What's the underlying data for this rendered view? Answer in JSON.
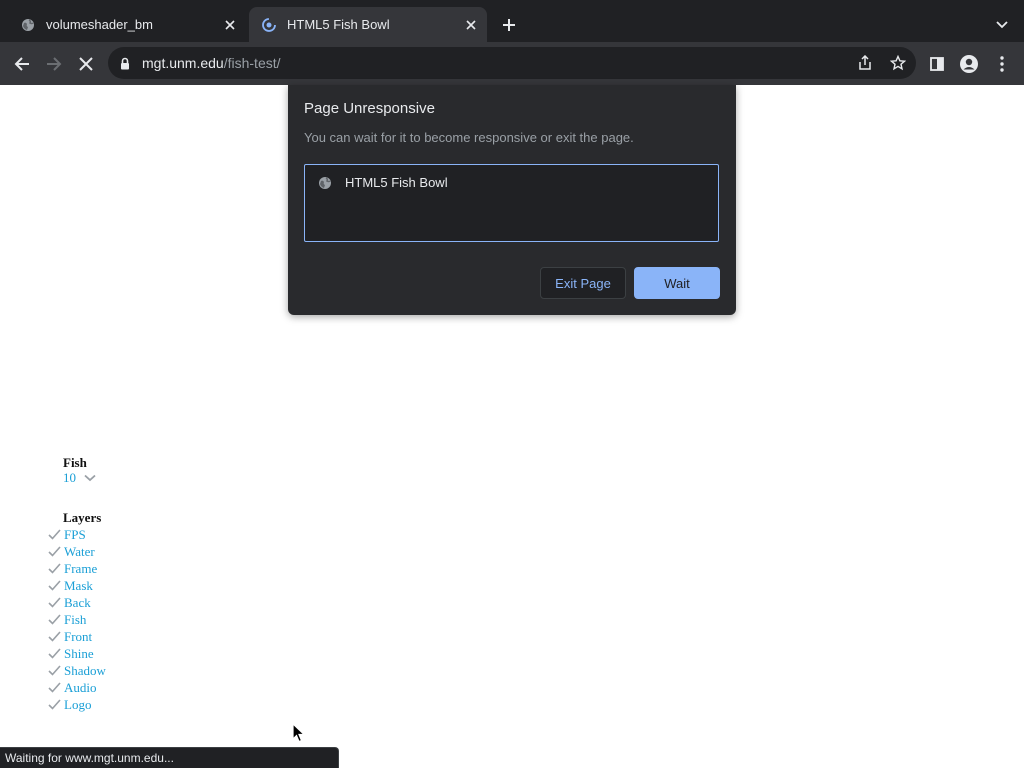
{
  "tabs": [
    {
      "title": "volumeshader_bm",
      "favicon": "globe-icon",
      "active": false
    },
    {
      "title": "HTML5 Fish Bowl",
      "favicon": "loading-spinner-icon",
      "active": true
    }
  ],
  "toolbar": {
    "url_host": "mgt.unm.edu",
    "url_path": "/fish-test/"
  },
  "dialog": {
    "title": "Page Unresponsive",
    "message": "You can wait for it to become responsive or exit the page.",
    "page_title": "HTML5 Fish Bowl",
    "exit_label": "Exit Page",
    "wait_label": "Wait"
  },
  "page": {
    "fish_heading": "Fish",
    "fish_count": "10",
    "layers_heading": "Layers",
    "layers": [
      "FPS",
      "Water",
      "Frame",
      "Mask",
      "Back",
      "Fish",
      "Front",
      "Shine",
      "Shadow",
      "Audio",
      "Logo"
    ]
  },
  "status": {
    "text": "Waiting for www.mgt.unm.edu..."
  },
  "colors": {
    "accent": "#8ab4f8",
    "link": "#1a9fd6",
    "chrome_dark": "#202124",
    "toolbar": "#35363a"
  }
}
